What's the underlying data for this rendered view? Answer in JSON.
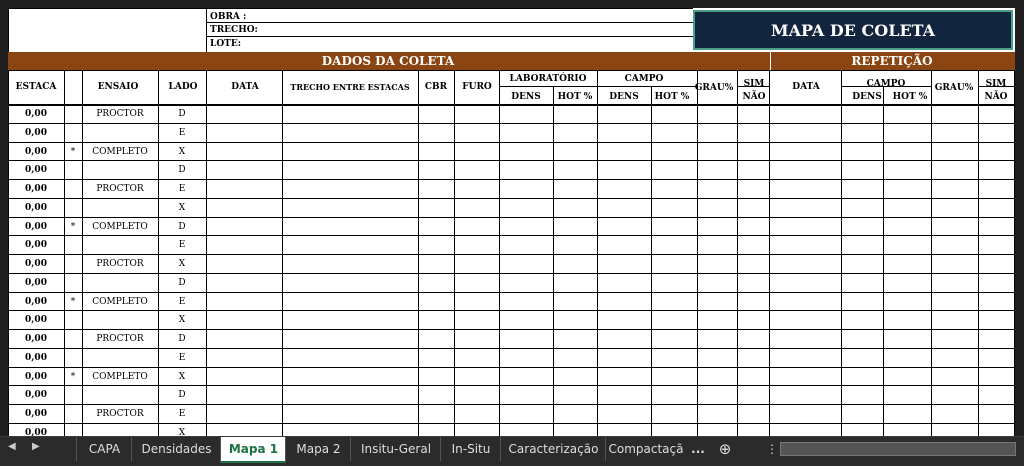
{
  "header": {
    "obra_label": "OBRA :",
    "trecho_label": "TRECHO:",
    "lote_label": "LOTE:",
    "map_title": "MAPA DE COLETA"
  },
  "sections": {
    "dados": "DADOS DA COLETA",
    "repeticao": "REPETIÇÃO"
  },
  "columns": {
    "estaca": "ESTACA",
    "ensaio": "ENSAIO",
    "lado": "LADO",
    "data": "DATA",
    "trecho": "TRECHO ENTRE ESTACAS",
    "cbr": "CBR",
    "furo": "FURO",
    "laboratorio": "LABORATÓRIO",
    "campo": "CAMPO",
    "dens": "DENS",
    "hot": "HOT %",
    "grau": "GRAU%",
    "sim": "SIM",
    "nao": "NÃO",
    "rep_data": "DATA",
    "rep_campo": "CAMPO",
    "rep_dens": "DENS",
    "rep_hot": "HOT %",
    "rep_grau": "GRAU%",
    "rep_sim": "SIM",
    "rep_nao": "NÃO"
  },
  "rows": [
    {
      "estaca": "0,00",
      "mark": "",
      "ensaio": "PROCTOR",
      "lado": "D"
    },
    {
      "estaca": "0,00",
      "mark": "",
      "ensaio": "",
      "lado": "E"
    },
    {
      "estaca": "0,00",
      "mark": "*",
      "ensaio": "COMPLETO",
      "lado": "X"
    },
    {
      "estaca": "0,00",
      "mark": "",
      "ensaio": "",
      "lado": "D"
    },
    {
      "estaca": "0,00",
      "mark": "",
      "ensaio": "PROCTOR",
      "lado": "E"
    },
    {
      "estaca": "0,00",
      "mark": "",
      "ensaio": "",
      "lado": "X"
    },
    {
      "estaca": "0,00",
      "mark": "*",
      "ensaio": "COMPLETO",
      "lado": "D"
    },
    {
      "estaca": "0,00",
      "mark": "",
      "ensaio": "",
      "lado": "E"
    },
    {
      "estaca": "0,00",
      "mark": "",
      "ensaio": "PROCTOR",
      "lado": "X"
    },
    {
      "estaca": "0,00",
      "mark": "",
      "ensaio": "",
      "lado": "D"
    },
    {
      "estaca": "0,00",
      "mark": "*",
      "ensaio": "COMPLETO",
      "lado": "E"
    },
    {
      "estaca": "0,00",
      "mark": "",
      "ensaio": "",
      "lado": "X"
    },
    {
      "estaca": "0,00",
      "mark": "",
      "ensaio": "PROCTOR",
      "lado": "D"
    },
    {
      "estaca": "0,00",
      "mark": "",
      "ensaio": "",
      "lado": "E"
    },
    {
      "estaca": "0,00",
      "mark": "*",
      "ensaio": "COMPLETO",
      "lado": "X"
    },
    {
      "estaca": "0,00",
      "mark": "",
      "ensaio": "",
      "lado": "D"
    },
    {
      "estaca": "0,00",
      "mark": "",
      "ensaio": "PROCTOR",
      "lado": "E"
    },
    {
      "estaca": "0,00",
      "mark": "",
      "ensaio": "",
      "lado": "X"
    }
  ],
  "tabs": [
    {
      "label": "CAPA",
      "active": false
    },
    {
      "label": "Densidades",
      "active": false
    },
    {
      "label": "Mapa 1",
      "active": true
    },
    {
      "label": "Mapa 2",
      "active": false
    },
    {
      "label": "Insitu-Geral",
      "active": false
    },
    {
      "label": "In-Situ",
      "active": false
    },
    {
      "label": "Caracterização",
      "active": false
    },
    {
      "label": "Compactaçã",
      "active": false
    }
  ],
  "tabbar": {
    "more": "...",
    "add_icon": "plus-circle-icon",
    "menu_icon": "vertical-ellipsis-icon",
    "prev_icon": "triangle-left-icon",
    "next_icon": "triangle-right-icon"
  },
  "colors": {
    "brown_bar": "#8B4513",
    "title_box": "#13243f",
    "active_tab_text": "#1e7145"
  }
}
